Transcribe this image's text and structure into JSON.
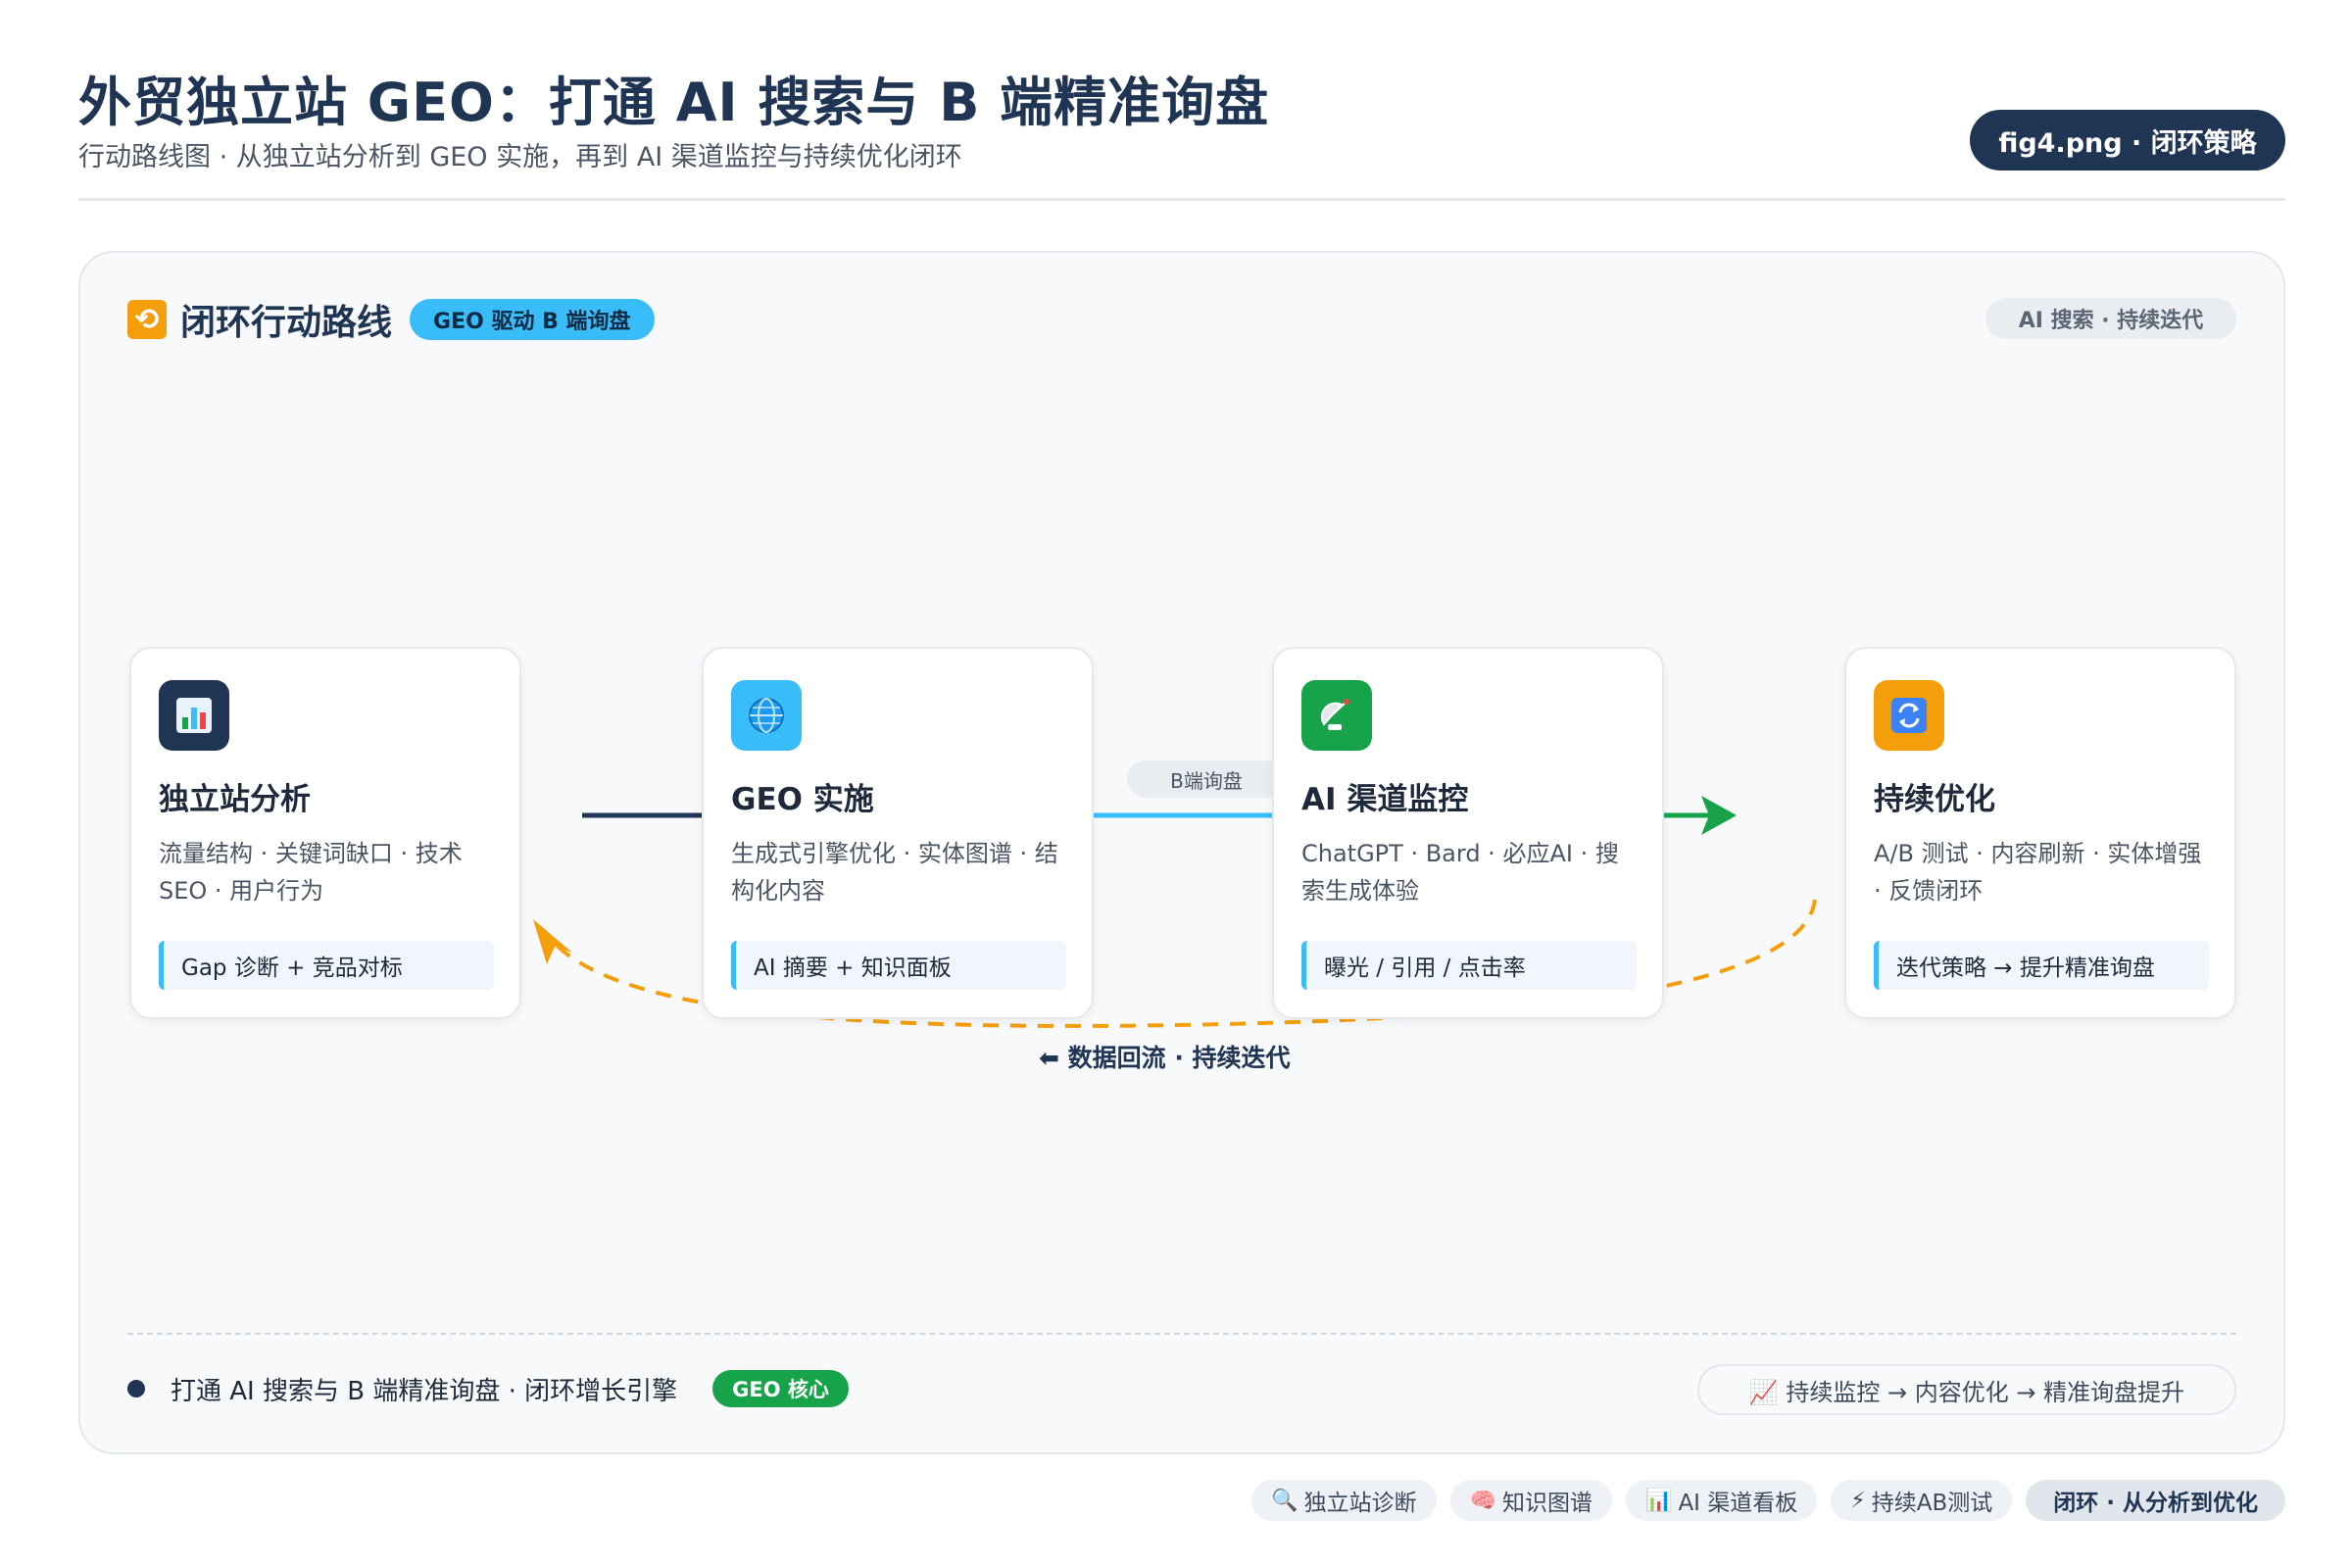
{
  "header": {
    "title": "外贸独立站 GEO：打通 AI 搜索与 B 端精准询盘",
    "subtitle": "行动路线图 · 从独立站分析到 GEO 实施，再到 AI 渠道监控与持续优化闭环",
    "file_badge": "fig4.png · 闭环策略"
  },
  "panel": {
    "title_icon": "loop-arrows-icon",
    "title": "闭环行动路线",
    "pill": "GEO 驱动 B 端询盘",
    "tag": "AI 搜索 · 持续迭代"
  },
  "steps": [
    {
      "icon": "bar-chart-icon",
      "icon_color": "#1f3553",
      "title": "独立站分析",
      "desc": "流量结构 · 关键词缺口 · 技术SEO · 用户行为",
      "note": "Gap 诊断 + 竞品对标"
    },
    {
      "icon": "globe-icon",
      "icon_color": "#38bdf8",
      "title": "GEO 实施",
      "desc": "生成式引擎优化 · 实体图谱 · 结构化内容",
      "note": "AI 摘要 + 知识面板"
    },
    {
      "icon": "satellite-antenna-icon",
      "icon_color": "#16a34a",
      "title": "AI 渠道监控",
      "desc": "ChatGPT · Bard · 必应AI · 搜索生成体验",
      "note": "曝光 / 引用 / 点击率"
    },
    {
      "icon": "refresh-icon",
      "icon_color": "#f59e0b",
      "title": "持续优化",
      "desc": "A/B 测试 · 内容刷新 · 实体增强 · 反馈闭环",
      "note": "迭代策略 → 提升精准询盘"
    }
  ],
  "connectors": {
    "edge_label": "B端询盘",
    "loop_label": "⬅ 数据回流 · 持续迭代",
    "colors": {
      "navy": "#1f3553",
      "sky": "#38bdf8",
      "green": "#16a34a",
      "orange": "#f59e0b"
    }
  },
  "footer": {
    "text": "打通 AI 搜索与 B 端精准询盘 · 闭环增长引擎",
    "badge": "GEO 核心",
    "flow": "📈 持续监控 → 内容优化 → 精准询盘提升"
  },
  "chips": [
    {
      "icon": "🔍",
      "label": "独立站诊断"
    },
    {
      "icon": "🧠",
      "label": "知识图谱"
    },
    {
      "icon": "📊",
      "label": "AI 渠道看板"
    },
    {
      "icon": "⚡",
      "label": "持续AB测试"
    }
  ],
  "chip_summary": "闭环 · 从分析到优化"
}
